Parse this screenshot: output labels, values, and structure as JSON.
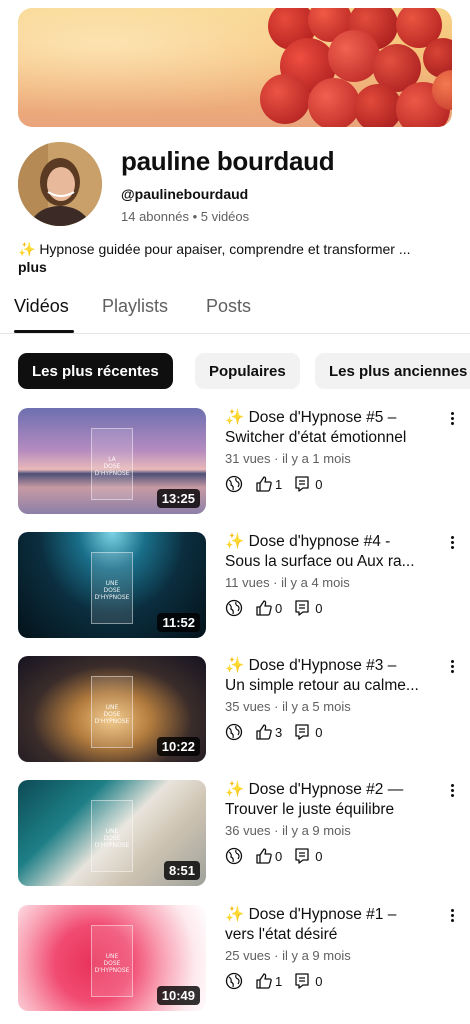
{
  "channel": {
    "name": "pauline bourdaud",
    "handle": "@paulinebourdaud",
    "stats": "14 abonnés • 5 vidéos",
    "description": "✨ Hypnose guidée pour apaiser, comprendre et transformer ...",
    "more_label": "plus"
  },
  "tabs": [
    {
      "label": "Vidéos",
      "active": true
    },
    {
      "label": "Playlists",
      "active": false
    },
    {
      "label": "Posts",
      "active": false
    }
  ],
  "filters": [
    {
      "label": "Les plus récentes",
      "active": true
    },
    {
      "label": "Populaires",
      "active": false
    },
    {
      "label": "Les plus anciennes",
      "active": false
    }
  ],
  "videos": [
    {
      "title_line1": "✨ Dose d'Hypnose #5 –",
      "title_line2": "Switcher d'état émotionnel",
      "meta": "31 vues · il y a 1 mois",
      "likes": "1",
      "comments": "0",
      "duration": "13:25",
      "card_text": "LA\nDOSE\nD'HYPNOSE",
      "thumb_style": "sunset"
    },
    {
      "title_line1": "✨ Dose d'hypnose #4 -",
      "title_line2": "Sous la surface ou Aux ra...",
      "meta": "11 vues · il y a 4 mois",
      "likes": "0",
      "comments": "0",
      "duration": "11:52",
      "card_text": "UNE\nDOSE\nD'HYPNOSE",
      "thumb_style": "underwater"
    },
    {
      "title_line1": "✨ Dose d'Hypnose #3 –",
      "title_line2": "Un simple retour au calme...",
      "meta": "35 vues · il y a 5 mois",
      "likes": "3",
      "comments": "0",
      "duration": "10:22",
      "card_text": "UNE\nDOSE\nD'HYPNOSE",
      "thumb_style": "lights"
    },
    {
      "title_line1": "✨ Dose d'Hypnose #2 —",
      "title_line2": "Trouver le juste équilibre",
      "meta": "36 vues · il y a 9 mois",
      "likes": "0",
      "comments": "0",
      "duration": "8:51",
      "card_text": "UNE\nDOSE\nD'HYPNOSE",
      "thumb_style": "waves"
    },
    {
      "title_line1": "✨ Dose d'Hypnose #1 –",
      "title_line2": "vers l'état désiré",
      "meta": "25 vues · il y a 9 mois",
      "likes": "1",
      "comments": "0",
      "duration": "10:49",
      "card_text": "UNE\nDOSE\nD'HYPNOSE",
      "thumb_style": "ink"
    }
  ],
  "colors": {
    "text_primary": "#0f0f0f",
    "text_secondary": "#606060",
    "chip_active_bg": "#0f0f0f",
    "chip_inactive_bg": "#f2f2f2"
  }
}
